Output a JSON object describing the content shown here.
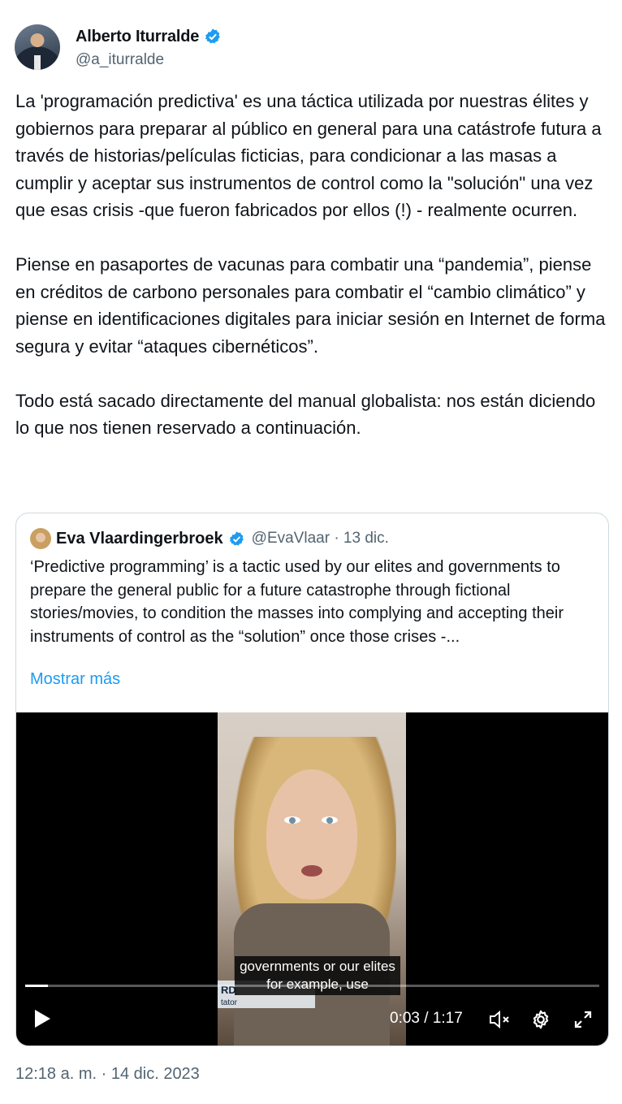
{
  "author": {
    "display_name": "Alberto Iturralde",
    "handle": "@a_iturralde",
    "verified": true
  },
  "tweet": {
    "text": "La 'programación predictiva' es una táctica utilizada por nuestras élites y gobiernos para preparar al público en general para una catástrofe futura a través de historias/películas ficticias, para condicionar a las masas a cumplir y aceptar sus instrumentos de control como la \"solución\" una vez que esas crisis -que fueron fabricados por ellos (!) - realmente ocurren.\n\nPiense en pasaportes de vacunas para combatir una “pandemia”, piense en créditos de carbono personales para combatir el “cambio climático” y piense en identificaciones digitales para iniciar sesión en Internet de forma segura y evitar “ataques cibernéticos”.\n\nTodo está sacado directamente del manual globalista: nos están diciendo lo que nos tienen reservado a continuación.",
    "timestamp": "12:18 a. m. · 14 dic. 2023"
  },
  "quoted_tweet": {
    "display_name": "Eva Vlaardingerbroek",
    "handle_date": "@EvaVlaar · 13 dic.",
    "verified": true,
    "text": "‘Predictive programming’ is a tactic used by our elites and governments to prepare the general public for a future catastrophe through fictional stories/movies, to condition the masses into complying and accepting their instruments of control as the “solution” once those crises -...",
    "show_more": "Mostrar más",
    "video": {
      "caption": "governments or our elites for example, use",
      "lower_third_name": "RD",
      "lower_third_role": "tator",
      "time": "0:03 / 1:17",
      "progress": 0.039,
      "muted": true
    }
  },
  "colors": {
    "text": "#0f1419",
    "secondary": "#536471",
    "link": "#1d9bf0",
    "verified": "#1d9bf0",
    "border": "#cfd9de"
  }
}
